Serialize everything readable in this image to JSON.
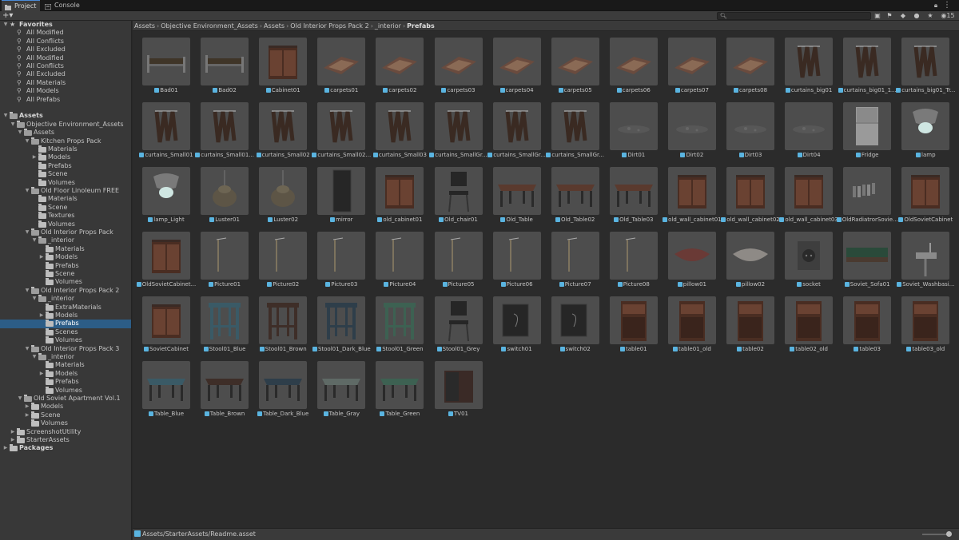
{
  "tabs": [
    {
      "label": "Project",
      "icon": "folder-icon"
    },
    {
      "label": "Console",
      "icon": "console-icon"
    }
  ],
  "toolbar": {
    "create_label": "+▾",
    "search_placeholder": ""
  },
  "sidebar": [
    {
      "label": "Favorites",
      "depth": 0,
      "arrow": "▼",
      "kind": "star",
      "bold": true
    },
    {
      "label": "All Modified",
      "depth": 1,
      "kind": "search"
    },
    {
      "label": "All Conflicts",
      "depth": 1,
      "kind": "search"
    },
    {
      "label": "All Excluded",
      "depth": 1,
      "kind": "search"
    },
    {
      "label": "All Modified",
      "depth": 1,
      "kind": "search"
    },
    {
      "label": "All Conflicts",
      "depth": 1,
      "kind": "search"
    },
    {
      "label": "All Excluded",
      "depth": 1,
      "kind": "search"
    },
    {
      "label": "All Materials",
      "depth": 1,
      "kind": "search"
    },
    {
      "label": "All Models",
      "depth": 1,
      "kind": "search"
    },
    {
      "label": "All Prefabs",
      "depth": 1,
      "kind": "search"
    },
    {
      "label": "",
      "depth": 0,
      "kind": "spacer"
    },
    {
      "label": "Assets",
      "depth": 0,
      "arrow": "▼",
      "kind": "folder-open",
      "bold": true
    },
    {
      "label": "Objective Environment_Assets",
      "depth": 1,
      "arrow": "▼",
      "kind": "folder-open"
    },
    {
      "label": "Assets",
      "depth": 2,
      "arrow": "▼",
      "kind": "folder-open"
    },
    {
      "label": "Kitchen Props Pack",
      "depth": 3,
      "arrow": "▼",
      "kind": "folder-open"
    },
    {
      "label": "Materials",
      "depth": 4,
      "kind": "folder"
    },
    {
      "label": "Models",
      "depth": 4,
      "arrow": "▶",
      "kind": "folder"
    },
    {
      "label": "Prefabs",
      "depth": 4,
      "kind": "folder"
    },
    {
      "label": "Scene",
      "depth": 4,
      "kind": "folder"
    },
    {
      "label": "Volumes",
      "depth": 4,
      "kind": "folder"
    },
    {
      "label": "Old Floor Linoleum FREE",
      "depth": 3,
      "arrow": "▼",
      "kind": "folder-open"
    },
    {
      "label": "Materials",
      "depth": 4,
      "kind": "folder"
    },
    {
      "label": "Scene",
      "depth": 4,
      "kind": "folder"
    },
    {
      "label": "Textures",
      "depth": 4,
      "kind": "folder"
    },
    {
      "label": "Volumes",
      "depth": 4,
      "kind": "folder"
    },
    {
      "label": "Old Interior Props Pack",
      "depth": 3,
      "arrow": "▼",
      "kind": "folder-open"
    },
    {
      "label": "_interior",
      "depth": 4,
      "arrow": "▼",
      "kind": "folder-open"
    },
    {
      "label": "Materials",
      "depth": 5,
      "kind": "folder"
    },
    {
      "label": "Models",
      "depth": 5,
      "arrow": "▶",
      "kind": "folder"
    },
    {
      "label": "Prefabs",
      "depth": 5,
      "kind": "folder"
    },
    {
      "label": "Scene",
      "depth": 5,
      "kind": "folder"
    },
    {
      "label": "Volumes",
      "depth": 5,
      "kind": "folder"
    },
    {
      "label": "Old Interior Props Pack 2",
      "depth": 3,
      "arrow": "▼",
      "kind": "folder-open"
    },
    {
      "label": "_interior",
      "depth": 4,
      "arrow": "▼",
      "kind": "folder-open"
    },
    {
      "label": "ExtraMaterials",
      "depth": 5,
      "kind": "folder"
    },
    {
      "label": "Models",
      "depth": 5,
      "arrow": "▶",
      "kind": "folder"
    },
    {
      "label": "Prefabs",
      "depth": 5,
      "kind": "folder",
      "selected": true
    },
    {
      "label": "Scenes",
      "depth": 5,
      "kind": "folder"
    },
    {
      "label": "Volumes",
      "depth": 5,
      "kind": "folder"
    },
    {
      "label": "Old Interior Props Pack 3",
      "depth": 3,
      "arrow": "▼",
      "kind": "folder-open"
    },
    {
      "label": "_interior",
      "depth": 4,
      "arrow": "▼",
      "kind": "folder-open"
    },
    {
      "label": "Materials",
      "depth": 5,
      "kind": "folder"
    },
    {
      "label": "Models",
      "depth": 5,
      "arrow": "▶",
      "kind": "folder"
    },
    {
      "label": "Prefabs",
      "depth": 5,
      "kind": "folder"
    },
    {
      "label": "Volumes",
      "depth": 5,
      "kind": "folder"
    },
    {
      "label": "Old Soviet Apartment Vol.1",
      "depth": 2,
      "arrow": "▼",
      "kind": "folder-open"
    },
    {
      "label": "Models",
      "depth": 3,
      "arrow": "▶",
      "kind": "folder"
    },
    {
      "label": "Scene",
      "depth": 3,
      "arrow": "▶",
      "kind": "folder"
    },
    {
      "label": "Volumes",
      "depth": 3,
      "kind": "folder"
    },
    {
      "label": "ScreenshotUtility",
      "depth": 1,
      "arrow": "▶",
      "kind": "folder"
    },
    {
      "label": "StarterAssets",
      "depth": 1,
      "arrow": "▶",
      "kind": "folder"
    },
    {
      "label": "Packages",
      "depth": 0,
      "arrow": "▶",
      "kind": "folder",
      "bold": true
    }
  ],
  "breadcrumb": [
    "Assets",
    "Objective Environment_Assets",
    "Assets",
    "Old Interior Props Pack 2",
    "_interior",
    "Prefabs"
  ],
  "assets": [
    {
      "name": "Bad01",
      "icon": "bed-icon"
    },
    {
      "name": "Bad02",
      "icon": "bed-icon"
    },
    {
      "name": "Cabinet01",
      "icon": "cabinet-icon"
    },
    {
      "name": "carpets01",
      "icon": "carpet-icon"
    },
    {
      "name": "carpets02",
      "icon": "carpet-icon"
    },
    {
      "name": "carpets03",
      "icon": "carpet-icon"
    },
    {
      "name": "carpets04",
      "icon": "carpet-icon"
    },
    {
      "name": "carpets05",
      "icon": "carpet-icon"
    },
    {
      "name": "carpets06",
      "icon": "carpet-icon"
    },
    {
      "name": "carpets07",
      "icon": "carpet-icon"
    },
    {
      "name": "carpets08",
      "icon": "carpet-icon"
    },
    {
      "name": "curtains_big01",
      "icon": "curtain-icon"
    },
    {
      "name": "curtains_big01_1...",
      "icon": "curtain-icon"
    },
    {
      "name": "curtains_big01_Tr...",
      "icon": "curtain-icon"
    },
    {
      "name": "curtains_Small01",
      "icon": "curtain-icon"
    },
    {
      "name": "curtains_Small01...",
      "icon": "curtain-icon"
    },
    {
      "name": "curtains_Small02",
      "icon": "curtain-icon"
    },
    {
      "name": "curtains_Small02...",
      "icon": "curtain-icon"
    },
    {
      "name": "curtains_Small03",
      "icon": "curtain-icon"
    },
    {
      "name": "curtains_SmallGr...",
      "icon": "curtain-icon"
    },
    {
      "name": "curtains_SmallGr...",
      "icon": "curtain-icon"
    },
    {
      "name": "curtains_SmallGr...",
      "icon": "curtain-icon"
    },
    {
      "name": "Dirt01",
      "icon": "dirt-icon"
    },
    {
      "name": "Dirt02",
      "icon": "dirt-icon"
    },
    {
      "name": "Dirt03",
      "icon": "dirt-icon"
    },
    {
      "name": "Dirt04",
      "icon": "dirt-icon"
    },
    {
      "name": "Fridge",
      "icon": "fridge-icon"
    },
    {
      "name": "lamp",
      "icon": "lamp-icon"
    },
    {
      "name": "lamp_Light",
      "icon": "lamp-icon"
    },
    {
      "name": "Luster01",
      "icon": "chandelier-icon"
    },
    {
      "name": "Luster02",
      "icon": "chandelier-icon"
    },
    {
      "name": "mirror",
      "icon": "mirror-icon"
    },
    {
      "name": "old_cabinet01",
      "icon": "cabinet-icon"
    },
    {
      "name": "Old_chair01",
      "icon": "chair-icon"
    },
    {
      "name": "Old_Table",
      "icon": "table-icon"
    },
    {
      "name": "Old_Table02",
      "icon": "table-icon"
    },
    {
      "name": "Old_Table03",
      "icon": "table-icon"
    },
    {
      "name": "old_wall_cabinet01",
      "icon": "cabinet-icon"
    },
    {
      "name": "old_wall_cabinet02",
      "icon": "cabinet-icon"
    },
    {
      "name": "old_wall_cabinet03",
      "icon": "cabinet-icon"
    },
    {
      "name": "OldRadiatrorSovie...",
      "icon": "radiator-icon"
    },
    {
      "name": "OldSovietCabinet",
      "icon": "cabinet-icon"
    },
    {
      "name": "OldSovietCabinet...",
      "icon": "cabinet-icon"
    },
    {
      "name": "Picture01",
      "icon": "picture-icon"
    },
    {
      "name": "Picture02",
      "icon": "picture-icon"
    },
    {
      "name": "Picture03",
      "icon": "picture-icon"
    },
    {
      "name": "Picture04",
      "icon": "picture-icon"
    },
    {
      "name": "Picture05",
      "icon": "picture-icon"
    },
    {
      "name": "Picture06",
      "icon": "picture-icon"
    },
    {
      "name": "Picture07",
      "icon": "picture-icon"
    },
    {
      "name": "Picture08",
      "icon": "picture-icon"
    },
    {
      "name": "pillow01",
      "icon": "pillow-icon"
    },
    {
      "name": "pillow02",
      "icon": "pillow-icon"
    },
    {
      "name": "socket",
      "icon": "socket-icon"
    },
    {
      "name": "Soviet_Sofa01",
      "icon": "sofa-icon"
    },
    {
      "name": "Soviet_Washbasi...",
      "icon": "washbasin-icon"
    },
    {
      "name": "SovietCabinet",
      "icon": "cabinet-icon"
    },
    {
      "name": "Stool01_Blue",
      "icon": "stool-icon"
    },
    {
      "name": "Stool01_Brown",
      "icon": "stool-icon"
    },
    {
      "name": "Stool01_Dark_Blue",
      "icon": "stool-icon"
    },
    {
      "name": "Stool01_Green",
      "icon": "stool-icon"
    },
    {
      "name": "Stool01_Grey",
      "icon": "chair-icon"
    },
    {
      "name": "switch01",
      "icon": "switch-icon"
    },
    {
      "name": "switch02",
      "icon": "switch-icon"
    },
    {
      "name": "table01",
      "icon": "nightstand-icon"
    },
    {
      "name": "table01_old",
      "icon": "nightstand-icon"
    },
    {
      "name": "table02",
      "icon": "nightstand-icon"
    },
    {
      "name": "table02_old",
      "icon": "nightstand-icon"
    },
    {
      "name": "table03",
      "icon": "nightstand-icon"
    },
    {
      "name": "table03_old",
      "icon": "nightstand-icon"
    },
    {
      "name": "Table_Blue",
      "icon": "table-icon"
    },
    {
      "name": "Table_Brown",
      "icon": "table-icon"
    },
    {
      "name": "Table_Dark_Blue",
      "icon": "table-icon"
    },
    {
      "name": "Table_Gray",
      "icon": "table-icon"
    },
    {
      "name": "Table_Green",
      "icon": "table-icon"
    },
    {
      "name": "TV01",
      "icon": "tv-icon"
    }
  ],
  "status": {
    "path": "Assets/StarterAssets/Readme.asset"
  },
  "colors": {
    "accent": "#2c5d87",
    "prefab_icon": "#5ab4e0",
    "background": "#282828"
  }
}
